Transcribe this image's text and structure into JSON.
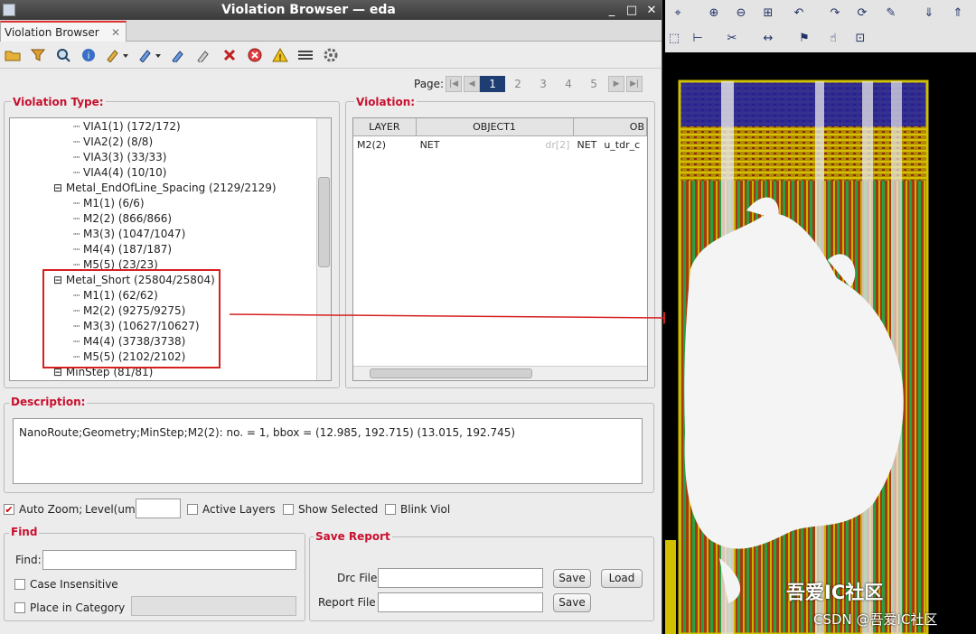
{
  "window": {
    "title": "Violation Browser — eda",
    "minimize": "_",
    "maximize": "□",
    "close": "✕"
  },
  "tab": {
    "label": "Violation Browser",
    "close": "✕"
  },
  "toolbar": {
    "icons": [
      "open-icon",
      "filter-icon",
      "zoom-select-icon",
      "info-icon",
      "prev-icon",
      "next-icon",
      "mark-icon",
      "unmark-icon",
      "delete-icon",
      "stop-icon",
      "warning-icon",
      "tools-icon",
      "settings-icon"
    ]
  },
  "pager": {
    "label": "Page:",
    "pages": [
      "1",
      "2",
      "3",
      "4",
      "5"
    ],
    "current": "1"
  },
  "violation_type": {
    "title": "Violation Type:",
    "rows": [
      "VIA1(1) (172/172)",
      "VIA2(2) (8/8)",
      "VIA3(3) (33/33)",
      "VIA4(4) (10/10)",
      "Metal_EndOfLine_Spacing (2129/2129)",
      "M1(1) (6/6)",
      "M2(2) (866/866)",
      "M3(3) (1047/1047)",
      "M4(4) (187/187)",
      "M5(5) (23/23)",
      "Metal_Short (25804/25804)",
      "M1(1) (62/62)",
      "M2(2) (9275/9275)",
      "M3(3) (10627/10627)",
      "M4(4) (3738/3738)",
      "M5(5) (2102/2102)",
      "MinStep (81/81)"
    ],
    "expand_sign": "⊟"
  },
  "violation": {
    "title": "Violation:",
    "columns": [
      "LAYER",
      "OBJECT1",
      "OB"
    ],
    "rows": [
      {
        "layer": "M2(2)",
        "obj_type": "NET",
        "obj_name": "dr[2]",
        "obj2_type": "NET",
        "obj2_name": "u_tdr_c"
      }
    ]
  },
  "description": {
    "title": "Description:",
    "text": "NanoRoute;Geometry;MinStep;M2(2): no. = 1, bbox = (12.985, 192.715) (13.015, 192.745)"
  },
  "options": {
    "auto_zoom": "Auto Zoom;",
    "level_label": "Level(um)",
    "active_layers": "Active Layers",
    "show_selected": "Show Selected",
    "blink_viol": "Blink Viol"
  },
  "find": {
    "title": "Find",
    "label": "Find:",
    "case_insensitive": "Case Insensitive",
    "place_in_category": "Place in Category"
  },
  "save_report": {
    "title": "Save Report",
    "drc_label": "Drc File",
    "report_label": "Report File",
    "save": "Save",
    "load": "Load"
  },
  "watermark": {
    "line1": "吾爱IC社区",
    "line2": "CSDN @吾爱IC社区"
  }
}
